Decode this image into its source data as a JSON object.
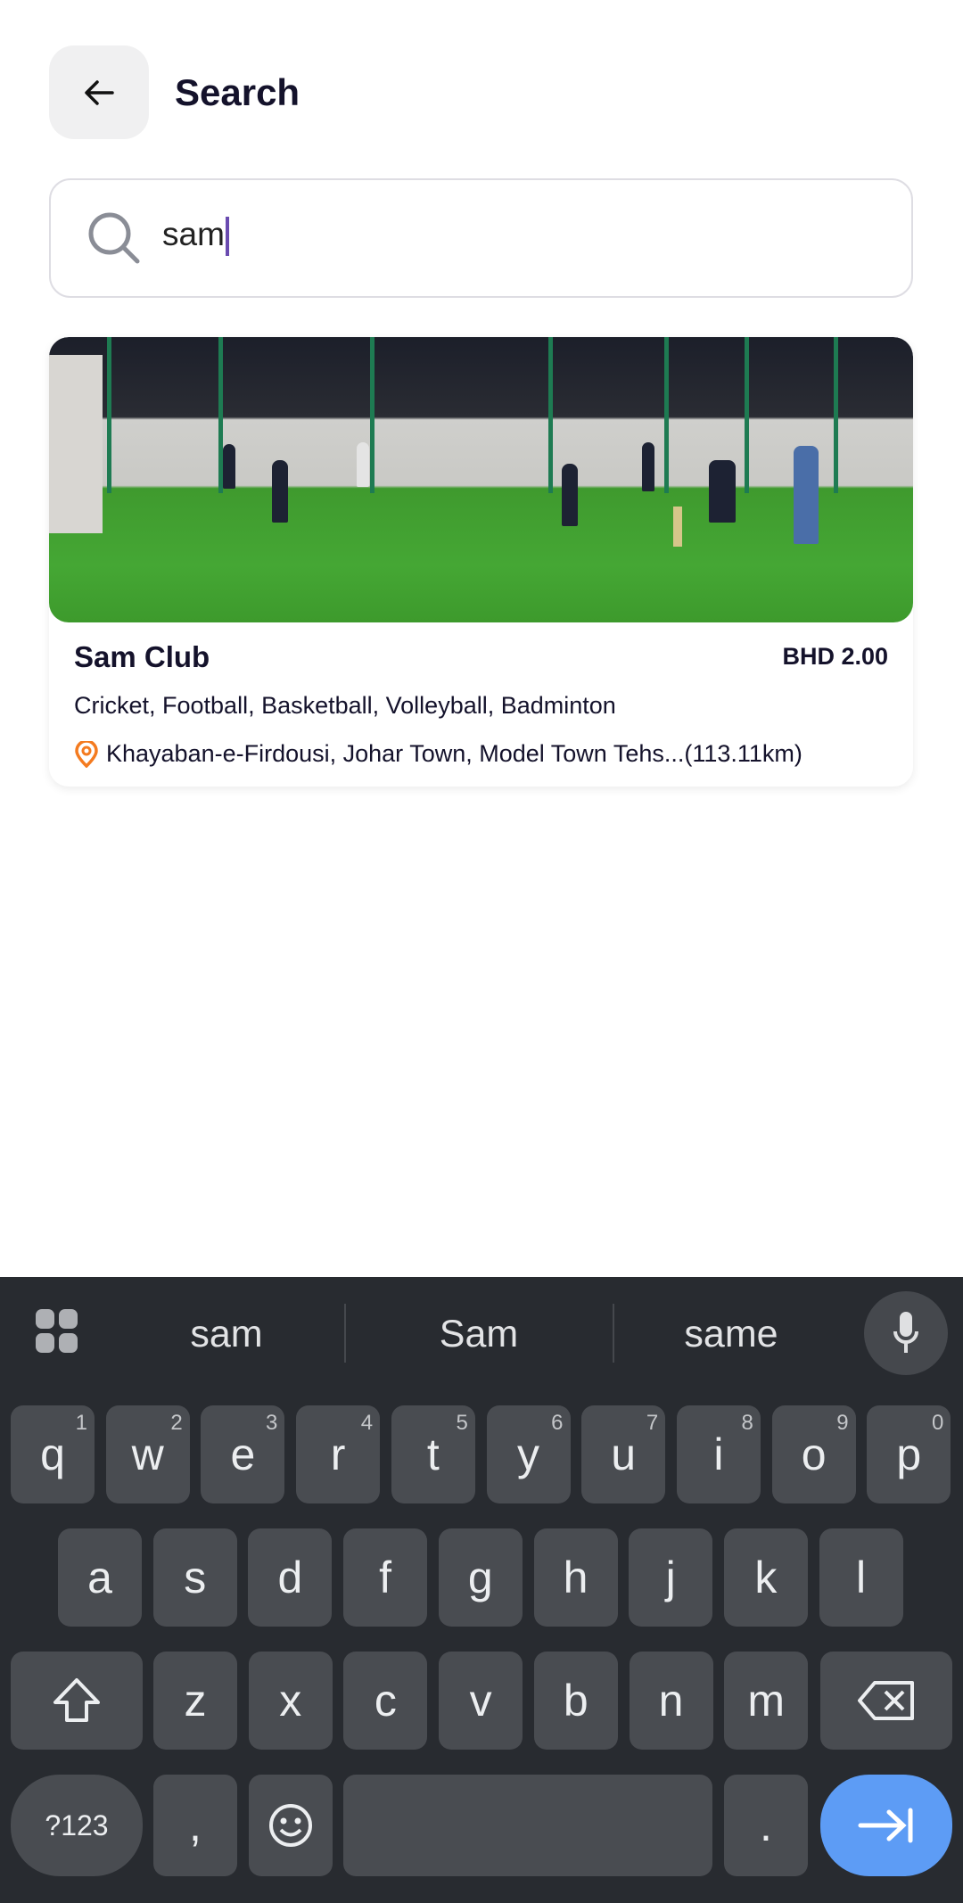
{
  "header": {
    "title": "Search"
  },
  "search": {
    "value": "sam"
  },
  "results": [
    {
      "name": "Sam Club",
      "price": "BHD 2.00",
      "sports": "Cricket, Football, Basketball, Volleyball, Badminton",
      "address": "Khayaban-e-Firdousi, Johar Town, Model Town Tehs...(113.11km)"
    }
  ],
  "keyboard": {
    "suggestions": [
      "sam",
      "Sam",
      "same"
    ],
    "row1": [
      [
        "q",
        "1"
      ],
      [
        "w",
        "2"
      ],
      [
        "e",
        "3"
      ],
      [
        "r",
        "4"
      ],
      [
        "t",
        "5"
      ],
      [
        "y",
        "6"
      ],
      [
        "u",
        "7"
      ],
      [
        "i",
        "8"
      ],
      [
        "o",
        "9"
      ],
      [
        "p",
        "0"
      ]
    ],
    "row2": [
      "a",
      "s",
      "d",
      "f",
      "g",
      "h",
      "j",
      "k",
      "l"
    ],
    "row3": [
      "z",
      "x",
      "c",
      "v",
      "b",
      "n",
      "m"
    ],
    "symbols": "?123",
    "comma": ",",
    "period": "."
  },
  "colors": {
    "accent": "#6a4bb0",
    "pin": "#f47b20",
    "enter": "#5d9cf5"
  }
}
